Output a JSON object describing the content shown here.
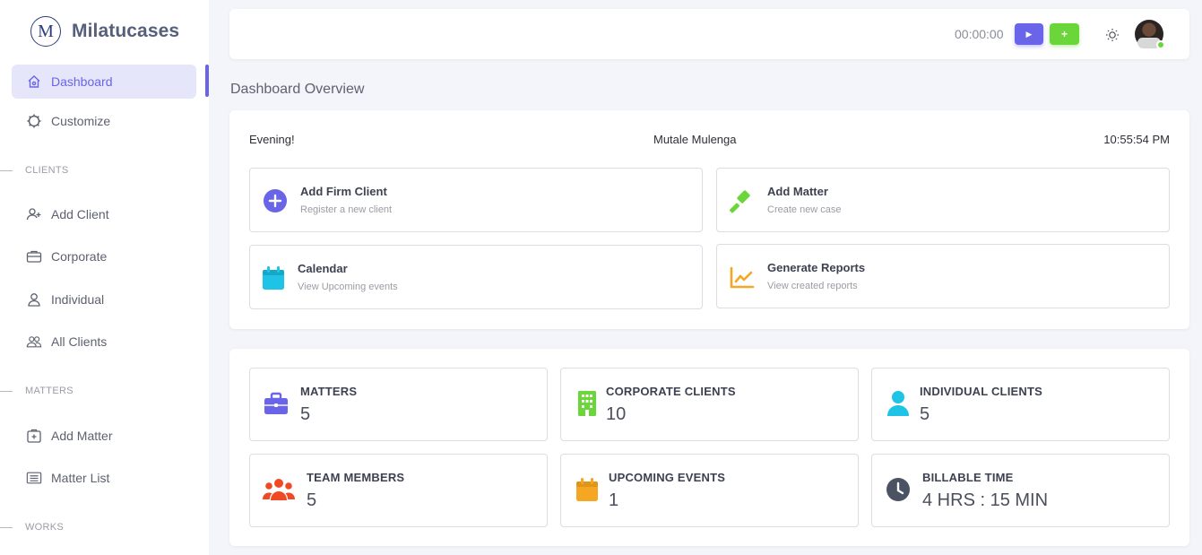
{
  "brand": {
    "logo_letter": "M",
    "name": "Milatucases"
  },
  "sidebar": {
    "items": [
      {
        "label": "Dashboard",
        "icon": "home-icon"
      },
      {
        "label": "Customize",
        "icon": "gear-icon"
      }
    ],
    "sections": [
      {
        "title": "CLIENTS",
        "items": [
          {
            "label": "Add Client",
            "icon": "user-plus-icon"
          },
          {
            "label": "Corporate",
            "icon": "briefcase-icon"
          },
          {
            "label": "Individual",
            "icon": "user-icon"
          },
          {
            "label": "All Clients",
            "icon": "users-icon"
          }
        ]
      },
      {
        "title": "MATTERS",
        "items": [
          {
            "label": "Add Matter",
            "icon": "folder-plus-icon"
          },
          {
            "label": "Matter List",
            "icon": "list-icon"
          }
        ]
      },
      {
        "title": "WORKS",
        "items": []
      }
    ]
  },
  "topbar": {
    "timer": "00:00:00",
    "play_label": "▶",
    "add_label": "+"
  },
  "page": {
    "title": "Dashboard Overview"
  },
  "overview": {
    "greeting": "Evening!",
    "user_name": "Mutale Mulenga",
    "time": "10:55:54 PM",
    "actions": [
      {
        "title": "Add Firm Client",
        "subtitle": "Register a new client",
        "icon": "plus-circle-icon",
        "color": "#6a64e8"
      },
      {
        "title": "Add Matter",
        "subtitle": "Create new case",
        "icon": "gavel-icon",
        "color": "#6bd63a"
      },
      {
        "title": "Calendar",
        "subtitle": "View Upcoming events",
        "icon": "calendar-icon",
        "color": "#1ec3e6"
      },
      {
        "title": "Generate Reports",
        "subtitle": "View created reports",
        "icon": "chart-line-icon",
        "color": "#f5a623"
      }
    ]
  },
  "stats": [
    {
      "label": "MATTERS",
      "value": "5",
      "icon": "briefcase-icon",
      "color": "#6a64e8"
    },
    {
      "label": "CORPORATE CLIENTS",
      "value": "10",
      "icon": "building-icon",
      "color": "#6bd63a"
    },
    {
      "label": "INDIVIDUAL CLIENTS",
      "value": "5",
      "icon": "user-icon",
      "color": "#1ec3e6"
    },
    {
      "label": "TEAM MEMBERS",
      "value": "5",
      "icon": "team-icon",
      "color": "#f04a24"
    },
    {
      "label": "UPCOMING EVENTS",
      "value": "1",
      "icon": "calendar-icon",
      "color": "#f5a623"
    },
    {
      "label": "BILLABLE TIME",
      "value": "4 HRS : 15 MIN",
      "icon": "clock-icon",
      "color": "#4b5263"
    }
  ]
}
